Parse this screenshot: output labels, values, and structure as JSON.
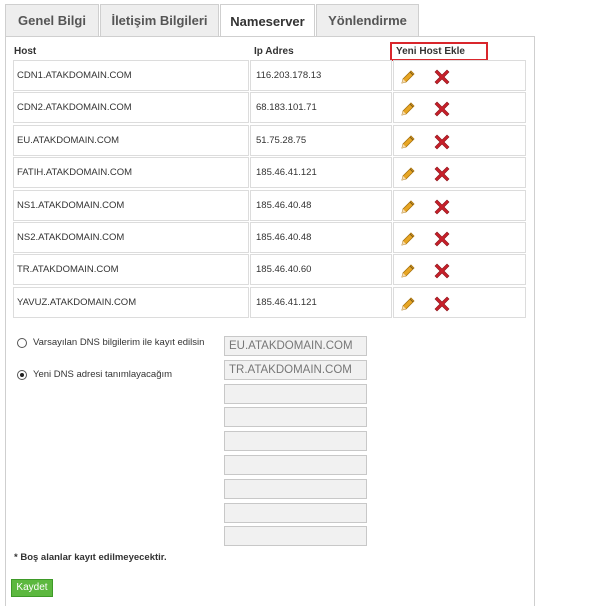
{
  "tabs": [
    {
      "label": "Genel Bilgi",
      "active": false
    },
    {
      "label": "İletişim Bilgileri",
      "active": false
    },
    {
      "label": "Nameserver",
      "active": true
    },
    {
      "label": "Yönlendirme",
      "active": false
    }
  ],
  "table": {
    "headers": {
      "host": "Host",
      "ip": "Ip Adres"
    },
    "add_host_label": "Yeni Host Ekle",
    "rows": [
      {
        "host": "CDN1.ATAKDOMAIN.COM",
        "ip": "116.203.178.13"
      },
      {
        "host": "CDN2.ATAKDOMAIN.COM",
        "ip": "68.183.101.71"
      },
      {
        "host": "EU.ATAKDOMAIN.COM",
        "ip": "51.75.28.75"
      },
      {
        "host": "FATIH.ATAKDOMAIN.COM",
        "ip": "185.46.41.121"
      },
      {
        "host": "NS1.ATAKDOMAIN.COM",
        "ip": "185.46.40.48"
      },
      {
        "host": "NS2.ATAKDOMAIN.COM",
        "ip": "185.46.40.48"
      },
      {
        "host": "TR.ATAKDOMAIN.COM",
        "ip": "185.46.40.60"
      },
      {
        "host": "YAVUZ.ATAKDOMAIN.COM",
        "ip": "185.46.41.121"
      }
    ]
  },
  "dns_options": [
    {
      "label": "Varsayılan DNS bilgilerim ile kayıt edilsin",
      "checked": false
    },
    {
      "label": "Yeni DNS adresi tanımlayacağım",
      "checked": true
    }
  ],
  "dns_inputs": [
    "EU.ATAKDOMAIN.COM",
    "TR.ATAKDOMAIN.COM",
    "",
    "",
    "",
    "",
    "",
    "",
    ""
  ],
  "note": "* Boş alanlar kayıt edilmeyecektir.",
  "save_label": "Kaydet",
  "colors": {
    "accent": "#5cb83f",
    "highlight_border": "#d9262c",
    "delete_icon": "#c8202a",
    "edit_icon": "#e8a624"
  }
}
